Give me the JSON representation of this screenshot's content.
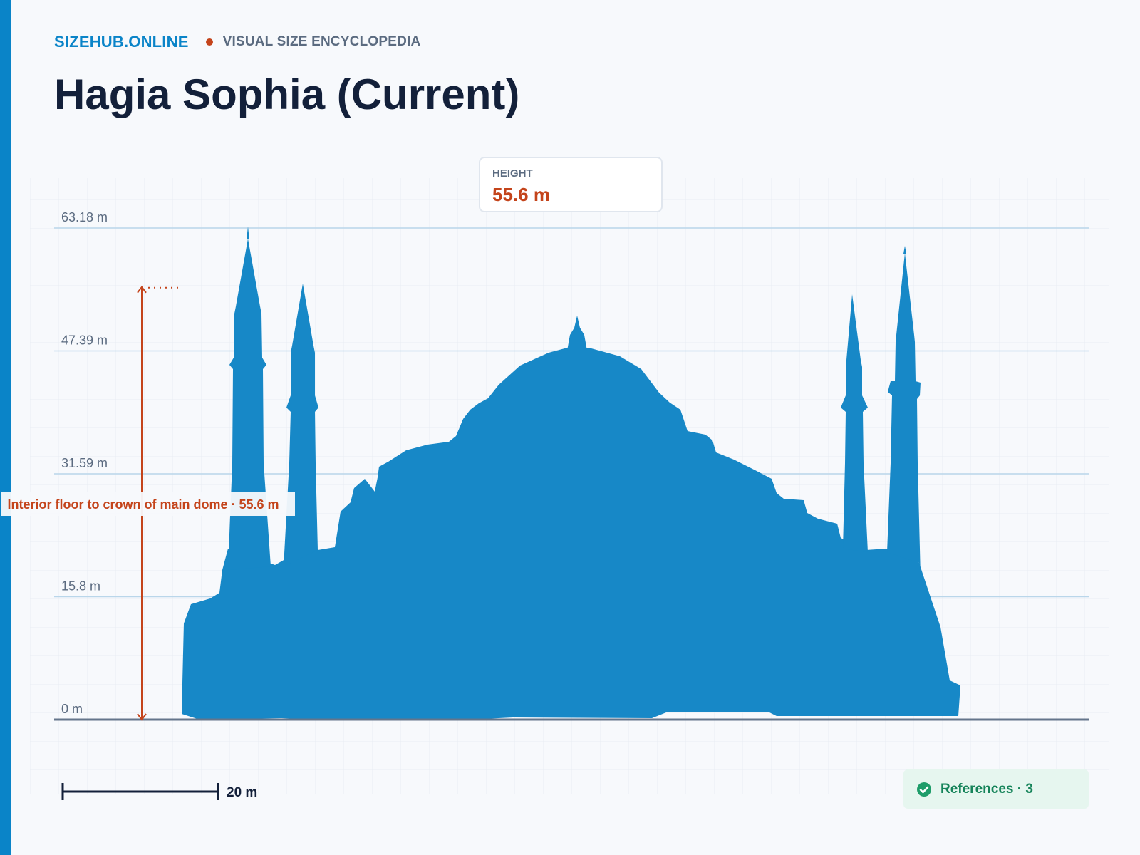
{
  "brand": {
    "name": "SIZEHUB.ONLINE",
    "tagline": "VISUAL SIZE ENCYCLOPEDIA"
  },
  "page_title": "Hagia Sophia (Current)",
  "height_card": {
    "label": "HEIGHT",
    "value": "55.6 m"
  },
  "chart_data": {
    "type": "diagram",
    "subject": "Hagia Sophia (Current)",
    "unit": "m",
    "y_ticks": [
      0,
      15.8,
      31.59,
      47.39,
      63.18
    ],
    "y_tick_labels": [
      "0 m",
      "15.8 m",
      "31.59 m",
      "47.39 m",
      "63.18 m"
    ],
    "ylim": [
      0,
      63.18
    ],
    "measurement": {
      "label": "Interior floor to crown of main dome · 55.6 m",
      "from_m": 0,
      "to_m": 55.6
    },
    "scale_bar": {
      "label": "20 m",
      "length_m": 20
    },
    "grid": true
  },
  "references": {
    "label": "References · 3",
    "count": 3
  },
  "colors": {
    "accent": "#0a84c8",
    "silhouette": "#1788c7",
    "measure": "#c4441b",
    "ink": "#13203a",
    "muted": "#5b6b80",
    "ref_bg": "#e6f6ef",
    "ref_text": "#16845a"
  }
}
